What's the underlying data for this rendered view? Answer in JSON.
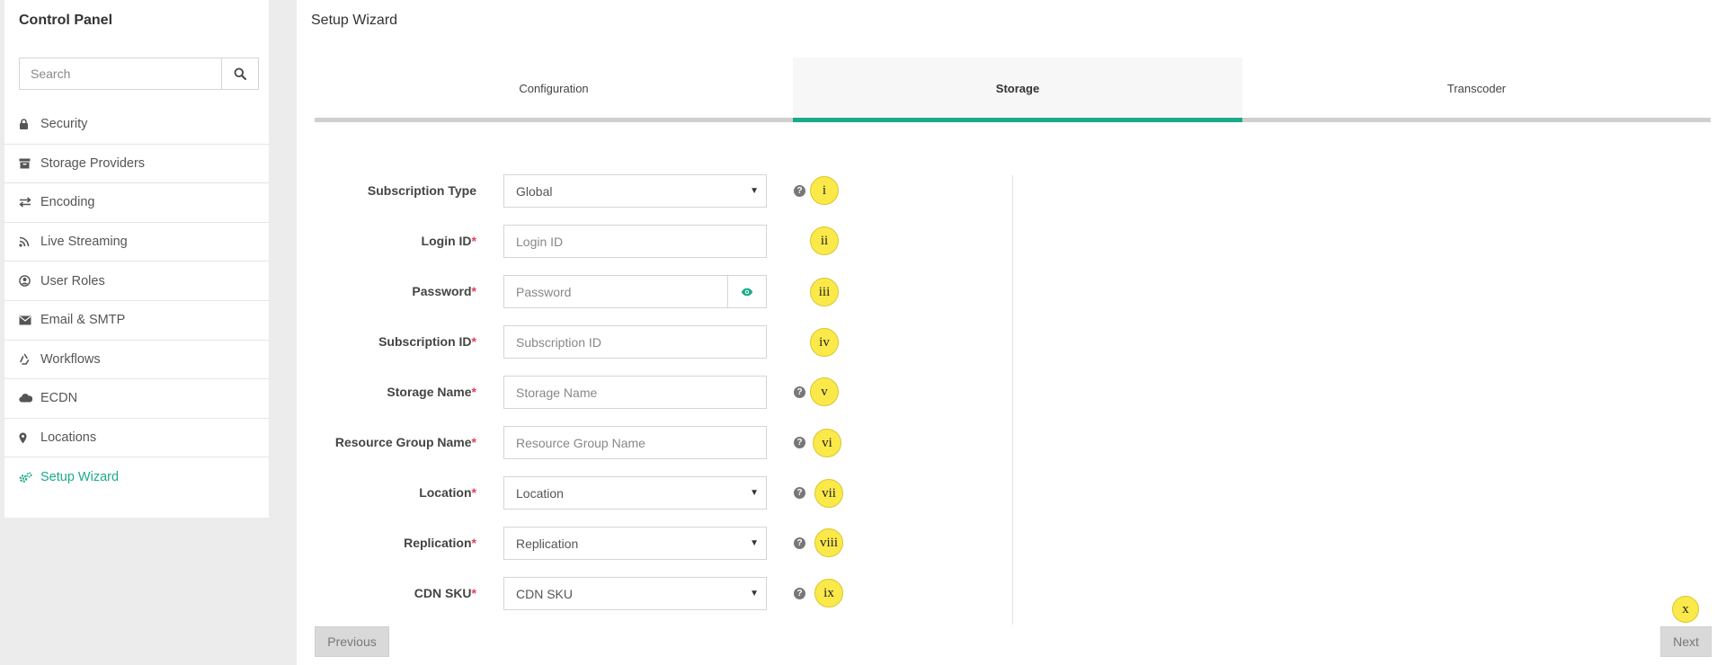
{
  "sidebar": {
    "title": "Control Panel",
    "search": {
      "placeholder": "Search",
      "value": ""
    },
    "items": [
      {
        "label": "Security",
        "icon": "lock-icon",
        "active": false
      },
      {
        "label": "Storage Providers",
        "icon": "archive-icon",
        "active": false
      },
      {
        "label": "Encoding",
        "icon": "exchange-icon",
        "active": false
      },
      {
        "label": "Live Streaming",
        "icon": "rss-icon",
        "active": false
      },
      {
        "label": "User Roles",
        "icon": "user-circle-icon",
        "active": false
      },
      {
        "label": "Email & SMTP",
        "icon": "envelope-icon",
        "active": false
      },
      {
        "label": "Workflows",
        "icon": "recycle-icon",
        "active": false
      },
      {
        "label": "ECDN",
        "icon": "cloud-icon",
        "active": false
      },
      {
        "label": "Locations",
        "icon": "map-marker-icon",
        "active": false
      },
      {
        "label": "Setup Wizard",
        "icon": "cogs-icon",
        "active": true
      }
    ]
  },
  "main": {
    "title": "Setup Wizard",
    "tabs": [
      {
        "label": "Configuration",
        "active": false
      },
      {
        "label": "Storage",
        "active": true
      },
      {
        "label": "Transcoder",
        "active": false
      }
    ],
    "form": {
      "subscription_type": {
        "label": "Subscription Type",
        "value": "Global",
        "badge": "i"
      },
      "login_id": {
        "label": "Login ID",
        "placeholder": "Login ID",
        "badge": "ii"
      },
      "password": {
        "label": "Password",
        "placeholder": "Password",
        "badge": "iii"
      },
      "subscription_id": {
        "label": "Subscription ID",
        "placeholder": "Subscription ID",
        "badge": "iv"
      },
      "storage_name": {
        "label": "Storage Name",
        "placeholder": "Storage Name",
        "badge": "v"
      },
      "resource_group": {
        "label": "Resource Group Name",
        "placeholder": "Resource Group Name",
        "badge": "vi"
      },
      "location": {
        "label": "Location",
        "value": "Location",
        "badge": "vii"
      },
      "replication": {
        "label": "Replication",
        "value": "Replication",
        "badge": "viii"
      },
      "cdn_sku": {
        "label": "CDN SKU",
        "value": "CDN SKU",
        "badge": "ix"
      },
      "required_mark": "*",
      "help_glyph": "?"
    },
    "buttons": {
      "previous": "Previous",
      "next": "Next",
      "next_badge": "x"
    }
  },
  "colors": {
    "accent": "#1aaa8a",
    "badge": "#fbe94a",
    "required": "#e0405a"
  }
}
